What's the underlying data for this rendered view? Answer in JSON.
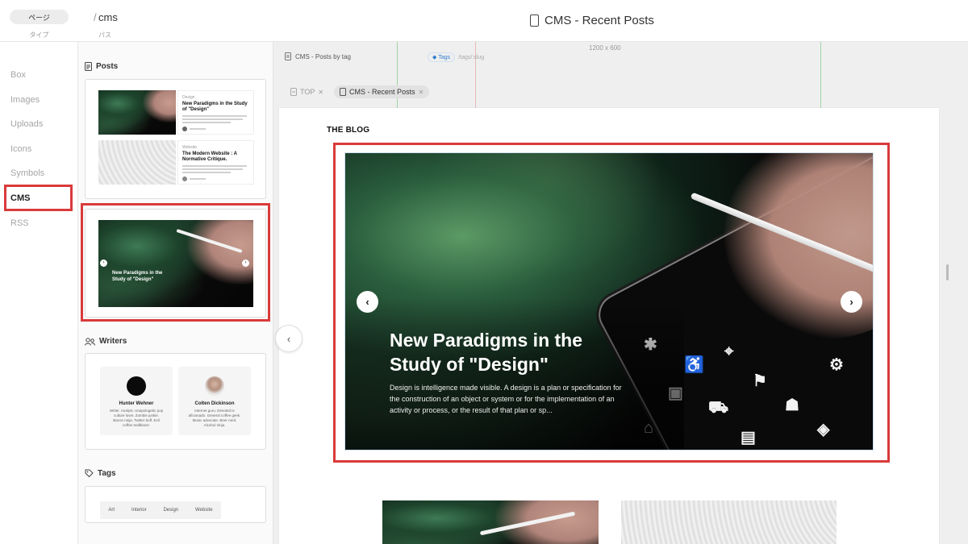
{
  "topbar": {
    "type_value": "ページ",
    "type_label": "タイプ",
    "path_slash": "/",
    "path_value": "cms",
    "path_label": "パス",
    "page_title": "CMS - Recent Posts"
  },
  "leftnav": {
    "items": [
      {
        "label": "Box"
      },
      {
        "label": "Images"
      },
      {
        "label": "Uploads"
      },
      {
        "label": "Icons"
      },
      {
        "label": "Symbols"
      },
      {
        "label": "CMS"
      },
      {
        "label": "RSS"
      }
    ]
  },
  "library": {
    "posts_title": "Posts",
    "writers_title": "Writers",
    "tags_title": "Tags",
    "post_cards": [
      {
        "title": "New Paradigms in the Study of \"Design\""
      },
      {
        "title": "The Modern Website : A Normative Critique."
      }
    ],
    "slider_title": "New Paradigms in the Study of \"Design\"",
    "writers": [
      {
        "name": "Hunter Wehner",
        "bio": "Writer. Analyst. Unapologetic pop culture lover. Zombie junkie. Bacon ninja. Twitter buff. Evil coffee trailblazer."
      },
      {
        "name": "Colten Dickinson",
        "bio": "Internet guru. Devoted tv aficionado. General coffee geek. Music advocate. Beer nerd. Alcohol ninja."
      }
    ],
    "tags": [
      "Art",
      "Interior",
      "Design",
      "Website"
    ]
  },
  "canvas": {
    "ruler_size": "1200 x 600",
    "breadcrumb_page": "CMS - Posts by tag",
    "breadcrumb_tag": "Tags",
    "breadcrumb_path": "/tags/:slug",
    "tabs": [
      {
        "label": "TOP"
      },
      {
        "label": "CMS - Recent Posts"
      }
    ],
    "blog_label": "THE BLOG",
    "hero_title": "New Paradigms in the Study of \"Design\"",
    "hero_body": "Design is intelligence made visible. A design is a plan or specification for the construction of an object or system or for the implementation of an activity or process, or the result of that plan or sp..."
  },
  "colors": {
    "highlight": "#d93a3a",
    "tag_blue": "#2f7dd1",
    "nav_inactive": "#a6a6a6"
  },
  "icons": [
    "doc-icon",
    "image-icon",
    "users-icon",
    "tag-icon",
    "chevron-left-icon",
    "chevron-right-icon",
    "close-icon"
  ]
}
